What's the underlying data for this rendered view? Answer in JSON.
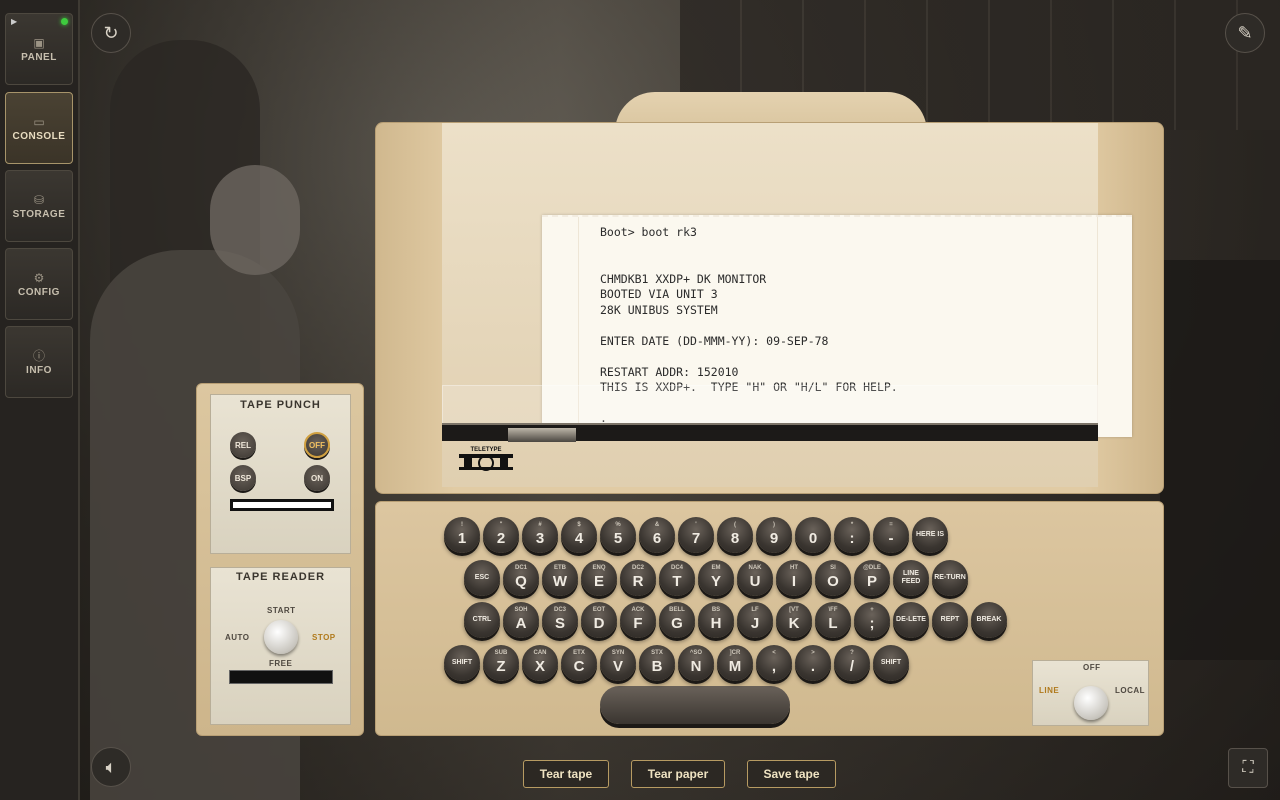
{
  "sidebar": {
    "items": [
      {
        "label": "PANEL",
        "icon": "panel-icon"
      },
      {
        "label": "CONSOLE",
        "icon": "console-icon",
        "active": true
      },
      {
        "label": "STORAGE",
        "icon": "storage-icon"
      },
      {
        "label": "CONFIG",
        "icon": "gear-icon"
      },
      {
        "label": "INFO",
        "icon": "info-icon"
      }
    ],
    "status_led": "green"
  },
  "printout": {
    "lines": [
      "Boot> boot rk3",
      "",
      "",
      "CHMDKB1 XXDP+ DK MONITOR",
      "BOOTED VIA UNIT 3",
      "28K UNIBUS SYSTEM",
      "",
      "ENTER DATE (DD-MMM-YY): 09-SEP-78",
      "",
      "RESTART ADDR: 152010",
      "THIS IS XXDP+.  TYPE \"H\" OR \"H/L\" FOR HELP.",
      "",
      "."
    ]
  },
  "brand": {
    "logo_text": "TELETYPE"
  },
  "tape_punch": {
    "title": "TAPE PUNCH",
    "buttons": {
      "rel": "REL",
      "off": "OFF",
      "bsp": "BSP",
      "on": "ON"
    }
  },
  "tape_reader": {
    "title": "TAPE READER",
    "start": "START",
    "auto": "AUTO",
    "stop": "STOP",
    "free": "FREE"
  },
  "keyboard": {
    "row1": [
      {
        "main": "1",
        "sub": "!"
      },
      {
        "main": "2",
        "sub": "\""
      },
      {
        "main": "3",
        "sub": "#"
      },
      {
        "main": "4",
        "sub": "$"
      },
      {
        "main": "5",
        "sub": "%"
      },
      {
        "main": "6",
        "sub": "&"
      },
      {
        "main": "7",
        "sub": "'"
      },
      {
        "main": "8",
        "sub": "("
      },
      {
        "main": "9",
        "sub": ")"
      },
      {
        "main": "0",
        "sub": ""
      },
      {
        "main": ":",
        "sub": "*"
      },
      {
        "main": "-",
        "sub": "="
      },
      {
        "main": "HERE IS",
        "sub": "",
        "word": true
      }
    ],
    "row2": [
      {
        "main": "ESC",
        "sub": "",
        "word": true
      },
      {
        "main": "Q",
        "sub": "DC1"
      },
      {
        "main": "W",
        "sub": "ETB"
      },
      {
        "main": "E",
        "sub": "ENQ"
      },
      {
        "main": "R",
        "sub": "DC2"
      },
      {
        "main": "T",
        "sub": "DC4"
      },
      {
        "main": "Y",
        "sub": "EM"
      },
      {
        "main": "U",
        "sub": "NAK"
      },
      {
        "main": "I",
        "sub": "HT"
      },
      {
        "main": "O",
        "sub": "SI"
      },
      {
        "main": "P",
        "sub": "@DLE"
      },
      {
        "main": "LINE FEED",
        "sub": "",
        "word": true
      },
      {
        "main": "RE-TURN",
        "sub": "",
        "word": true
      }
    ],
    "row3": [
      {
        "main": "CTRL",
        "sub": "",
        "word": true
      },
      {
        "main": "A",
        "sub": "SOH"
      },
      {
        "main": "S",
        "sub": "DC3"
      },
      {
        "main": "D",
        "sub": "EOT"
      },
      {
        "main": "F",
        "sub": "ACK"
      },
      {
        "main": "G",
        "sub": "BELL"
      },
      {
        "main": "H",
        "sub": "BS"
      },
      {
        "main": "J",
        "sub": "LF"
      },
      {
        "main": "K",
        "sub": "[VT"
      },
      {
        "main": "L",
        "sub": "\\FF"
      },
      {
        "main": ";",
        "sub": "+"
      },
      {
        "main": "DE-LETE",
        "sub": "",
        "word": true
      },
      {
        "main": "REPT",
        "sub": "",
        "word": true
      },
      {
        "main": "BREAK",
        "sub": "",
        "word": true
      }
    ],
    "row4": [
      {
        "main": "SHIFT",
        "sub": "",
        "word": true
      },
      {
        "main": "Z",
        "sub": "SUB"
      },
      {
        "main": "X",
        "sub": "CAN"
      },
      {
        "main": "C",
        "sub": "ETX"
      },
      {
        "main": "V",
        "sub": "SYN"
      },
      {
        "main": "B",
        "sub": "STX"
      },
      {
        "main": "N",
        "sub": "^SO"
      },
      {
        "main": "M",
        "sub": "]CR"
      },
      {
        "main": ",",
        "sub": "<"
      },
      {
        "main": ".",
        "sub": ">"
      },
      {
        "main": "/",
        "sub": "?"
      },
      {
        "main": "SHIFT",
        "sub": "",
        "word": true
      }
    ]
  },
  "mode_switch": {
    "off": "OFF",
    "line": "LINE",
    "local": "LOCAL"
  },
  "actions": {
    "tear_tape": "Tear tape",
    "tear_paper": "Tear paper",
    "save_tape": "Save tape"
  },
  "icons": {
    "reset": "refresh-icon",
    "magic": "magic-wand-icon",
    "sound": "speaker-icon",
    "fullscreen": "fullscreen-icon"
  },
  "colors": {
    "accent": "#b79b62",
    "case": "#dcc6a0",
    "led": "#3ecb3e"
  }
}
